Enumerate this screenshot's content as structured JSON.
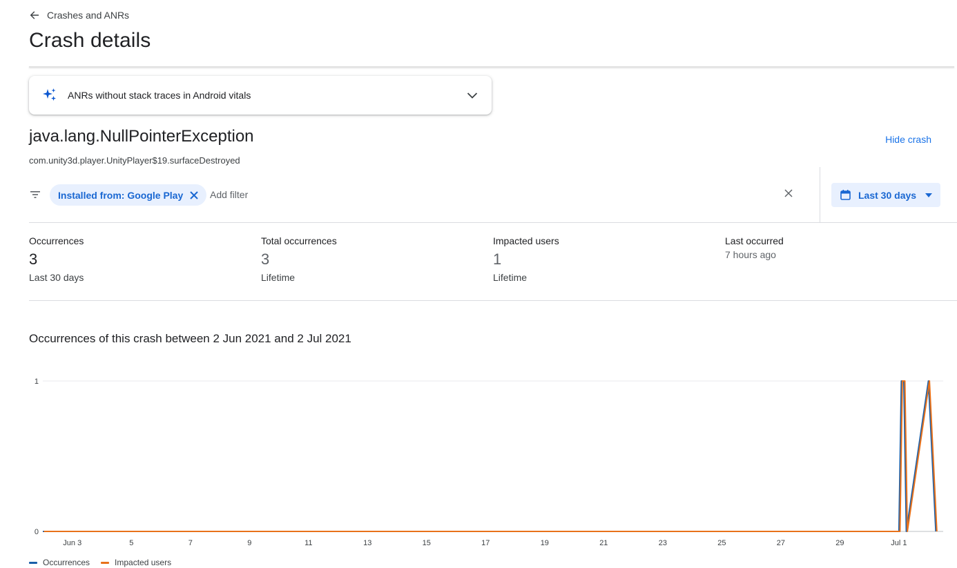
{
  "breadcrumb": {
    "back_label": "Crashes and ANRs"
  },
  "page": {
    "title": "Crash details"
  },
  "promo": {
    "text": "ANRs without stack traces in Android vitals"
  },
  "crash": {
    "exception": "java.lang.NullPointerException",
    "location": "com.unity3d.player.UnityPlayer$19.surfaceDestroyed",
    "hide_label": "Hide crash"
  },
  "filters": {
    "chip_label": "Installed from: Google Play",
    "add_placeholder": "Add filter",
    "date_range": "Last 30 days"
  },
  "stats": [
    {
      "label": "Occurrences",
      "value": "3",
      "sub": "Last 30 days"
    },
    {
      "label": "Total occurrences",
      "value": "3",
      "sub": "Lifetime"
    },
    {
      "label": "Impacted users",
      "value": "1",
      "sub": "Lifetime"
    },
    {
      "label": "Last occurred",
      "value": "7 hours ago"
    }
  ],
  "chart_title": "Occurrences of this crash between 2 Jun 2021 and 2 Jul 2021",
  "colors": {
    "accent": "#1a73e8",
    "occurrences": "#1a5fa8",
    "impacted_users": "#e8711a"
  },
  "chart_data": {
    "type": "line",
    "title": "Occurrences of this crash between 2 Jun 2021 and 2 Jul 2021",
    "x": [
      "2021-06-02",
      "2021-06-03",
      "2021-06-04",
      "2021-06-05",
      "2021-06-06",
      "2021-06-07",
      "2021-06-08",
      "2021-06-09",
      "2021-06-10",
      "2021-06-11",
      "2021-06-12",
      "2021-06-13",
      "2021-06-14",
      "2021-06-15",
      "2021-06-16",
      "2021-06-17",
      "2021-06-18",
      "2021-06-19",
      "2021-06-20",
      "2021-06-21",
      "2021-06-22",
      "2021-06-23",
      "2021-06-24",
      "2021-06-25",
      "2021-06-26",
      "2021-06-27",
      "2021-06-28",
      "2021-06-29",
      "2021-06-30",
      "2021-07-01",
      "2021-07-01T02",
      "2021-07-01T04",
      "2021-07-01T06",
      "2021-07-02",
      "2021-07-02T06"
    ],
    "series": [
      {
        "name": "Occurrences",
        "values": [
          0,
          0,
          0,
          0,
          0,
          0,
          0,
          0,
          0,
          0,
          0,
          0,
          0,
          0,
          0,
          0,
          0,
          0,
          0,
          0,
          0,
          0,
          0,
          0,
          0,
          0,
          0,
          0,
          0,
          0,
          1,
          1,
          0,
          1,
          0
        ]
      },
      {
        "name": "Impacted users",
        "values": [
          0,
          0,
          0,
          0,
          0,
          0,
          0,
          0,
          0,
          0,
          0,
          0,
          0,
          0,
          0,
          0,
          0,
          0,
          0,
          0,
          0,
          0,
          0,
          0,
          0,
          0,
          0,
          0,
          0,
          0,
          1,
          1,
          0,
          1,
          0
        ]
      }
    ],
    "x_ticks": [
      "Jun 3",
      "5",
      "7",
      "9",
      "11",
      "13",
      "15",
      "17",
      "19",
      "21",
      "23",
      "25",
      "27",
      "29",
      "Jul 1"
    ],
    "y_ticks": [
      "0",
      "1"
    ],
    "ylim": [
      0,
      1
    ],
    "legend": "bottom-left",
    "grid": true
  }
}
